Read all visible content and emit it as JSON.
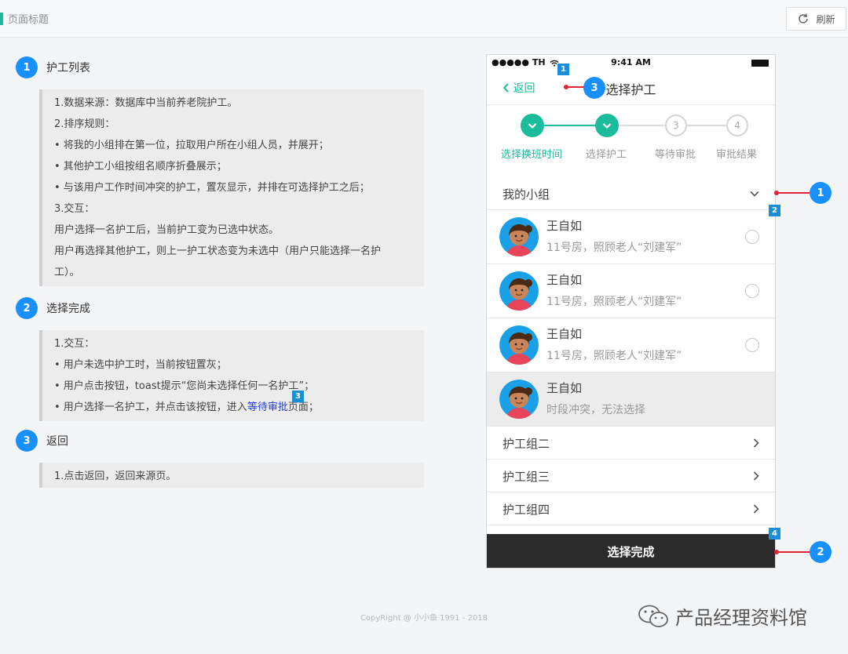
{
  "header": {
    "title": "页面标题",
    "refresh_label": "刷新"
  },
  "sections": [
    {
      "number": "1",
      "title": "护工列表",
      "lines": [
        "1.数据来源：数据库中当前养老院护工。",
        "2.排序规则：",
        "• 将我的小组排在第一位，拉取用户所在小组人员，并展开；",
        "• 其他护工小组按组名顺序折叠展示；",
        "• 与该用户工作时间冲突的护工，置灰显示，并排在可选择护工之后；",
        "3.交互：",
        "用户选择一名护工后，当前护工变为已选中状态。",
        "用户再选择其他护工，则上一护工状态变为未选中（用户只能选择一名护",
        "工）。"
      ]
    },
    {
      "number": "2",
      "title": "选择完成",
      "lines": [
        "1.交互：",
        "• 用户未选中护工时，当前按钮置灰；",
        "• 用户点击按钮，toast提示“您尚未选择任何一名护工”；",
        "• 用户选择一名护工，并点击该按钮，进入"
      ],
      "link_text": "等待审批",
      "link_suffix": "页面；",
      "link_badge": "3"
    },
    {
      "number": "3",
      "title": "返回",
      "lines": [
        "1.点击返回，返回来源页。"
      ]
    }
  ],
  "phone": {
    "status": {
      "carrier": "●●●●● TH",
      "time": "9:41 AM"
    },
    "back_label": "返回",
    "nav_title": "选择护工",
    "steps": [
      {
        "num": "1",
        "label": "选择换班时间",
        "state": "done"
      },
      {
        "num": "2",
        "label": "选择护工",
        "state": "done"
      },
      {
        "num": "3",
        "label": "等待审批",
        "state": "todo"
      },
      {
        "num": "4",
        "label": "审批结果",
        "state": "todo"
      }
    ],
    "my_group": "我的小组",
    "nurses": [
      {
        "name": "王自如",
        "sub": "11号房，照顾老人“刘建军”"
      },
      {
        "name": "王自如",
        "sub": "11号房，照顾老人“刘建军”"
      },
      {
        "name": "王自如",
        "sub": "11号房，照顾老人“刘建军”"
      },
      {
        "name": "王自如",
        "sub": "时段冲突，无法选择"
      }
    ],
    "other_groups": [
      "护工组二",
      "护工组三",
      "护工组四"
    ],
    "done_label": "选择完成"
  },
  "callouts": {
    "c1": "1",
    "c2": "2",
    "c3": "3",
    "s1": "1",
    "s2": "2",
    "s4": "4"
  },
  "footer": {
    "copyright": "CopyRight @ 小小鱼 1991 - 2018",
    "watermark": "产品经理资料馆"
  },
  "colors": {
    "accent": "#1abc9c",
    "badge": "#1890ff",
    "callout": "#e0243a"
  }
}
